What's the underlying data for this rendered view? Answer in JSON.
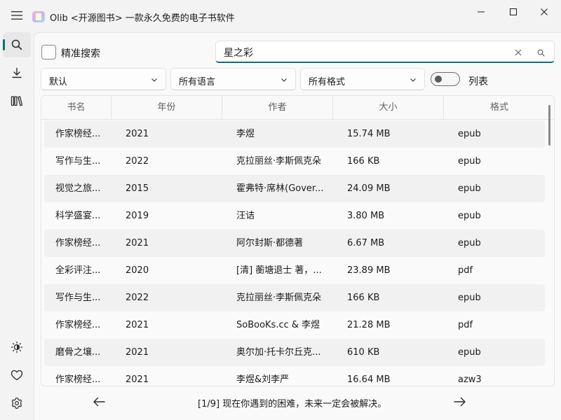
{
  "window": {
    "title": "Olib <开源图书> 一款永久免费的电子书软件"
  },
  "sidebar": {
    "items": [
      {
        "icon": "search-icon",
        "active": true
      },
      {
        "icon": "download-icon",
        "active": false
      },
      {
        "icon": "library-icon",
        "active": false
      }
    ],
    "bottom_items": [
      {
        "icon": "theme-icon"
      },
      {
        "icon": "heart-icon"
      },
      {
        "icon": "settings-icon"
      }
    ]
  },
  "filters": {
    "exact_search_label": "精准搜索",
    "search_value": "星之彩",
    "sort_selected": "默认",
    "language_selected": "所有语言",
    "format_selected": "所有格式",
    "list_toggle_label": "列表"
  },
  "table": {
    "columns": [
      "书名",
      "年份",
      "作者",
      "大小",
      "格式"
    ],
    "rows": [
      {
        "title": "作家榜经...",
        "year": "2021",
        "author": "李煜",
        "size": "15.74 MB",
        "format": "epub"
      },
      {
        "title": "写作与生...",
        "year": "2022",
        "author": "克拉丽丝·李斯佩克朵",
        "size": "166 KB",
        "format": "epub"
      },
      {
        "title": "视觉之旅...",
        "year": "2015",
        "author": "霍弗特·席林(Gover...",
        "size": "24.09 MB",
        "format": "epub"
      },
      {
        "title": "科学盛宴...",
        "year": "2019",
        "author": "汪诘",
        "size": "3.80 MB",
        "format": "epub"
      },
      {
        "title": "作家榜经...",
        "year": "2021",
        "author": "阿尔封斯·都德著",
        "size": "6.67 MB",
        "format": "epub"
      },
      {
        "title": "全彩评注...",
        "year": "2020",
        "author": "[清] 蘅塘退士 著，...",
        "size": "23.89 MB",
        "format": "pdf"
      },
      {
        "title": "写作与生...",
        "year": "2022",
        "author": "克拉丽丝·李斯佩克朵",
        "size": "166 KB",
        "format": "epub"
      },
      {
        "title": "作家榜经...",
        "year": "2021",
        "author": "SoBooKs.cc & 李煜",
        "size": "21.28 MB",
        "format": "pdf"
      },
      {
        "title": "磨骨之壤...",
        "year": "2021",
        "author": "奥尔加·托卡尔丘克...",
        "size": "610 KB",
        "format": "epub"
      },
      {
        "title": "作家榜经...",
        "year": "2021",
        "author": "李煜&刘李严",
        "size": "16.64 MB",
        "format": "azw3"
      }
    ]
  },
  "footer": {
    "message": "[1/9] 现在你遇到的困难，未来一定会被解决。"
  },
  "colors": {
    "accent": "#0f6f76",
    "row_alt": "#f1f1f1"
  }
}
